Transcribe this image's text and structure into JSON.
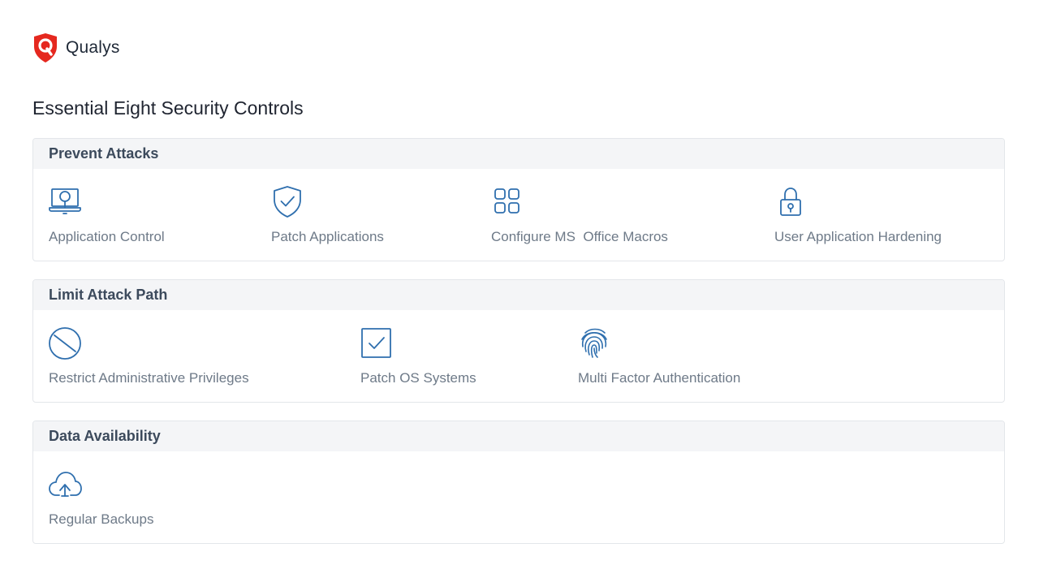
{
  "brand": {
    "name": "Qualys",
    "logo_color": "#e5281f"
  },
  "page_title": "Essential Eight Security Controls",
  "accent_color": "#2f6fae",
  "sections": [
    {
      "title": "Prevent Attacks",
      "items": [
        {
          "label": "Application Control",
          "icon": "laptop-search-icon"
        },
        {
          "label": "Patch Applications",
          "icon": "shield-check-icon"
        },
        {
          "label": "Configure MS  Office Macros",
          "icon": "grid-apps-icon"
        },
        {
          "label": "User Application Hardening",
          "icon": "padlock-icon"
        }
      ]
    },
    {
      "title": "Limit Attack Path",
      "items": [
        {
          "label": "Restrict Administrative Privileges",
          "icon": "prohibited-icon"
        },
        {
          "label": "Patch OS Systems",
          "icon": "checkbox-icon"
        },
        {
          "label": "Multi Factor Authentication",
          "icon": "fingerprint-icon"
        }
      ]
    },
    {
      "title": "Data Availability",
      "items": [
        {
          "label": "Regular Backups",
          "icon": "cloud-upload-icon"
        }
      ]
    }
  ]
}
